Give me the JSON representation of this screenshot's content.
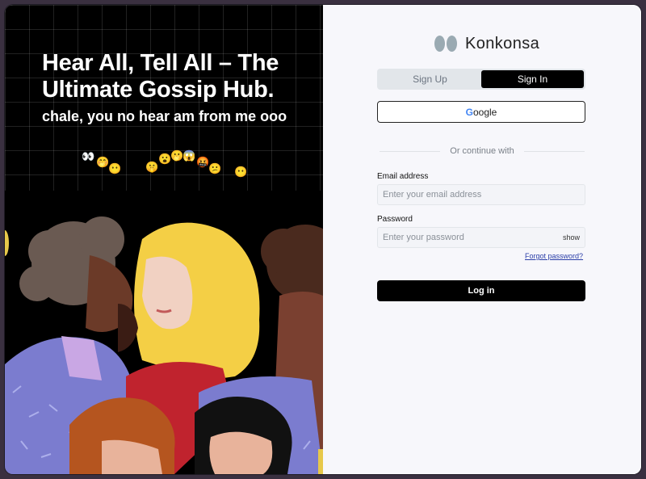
{
  "hero": {
    "title": "Hear All, Tell All – The Ultimate Gossip Hub.",
    "subtitle": "chale, you no hear am from me ooo",
    "emojis": [
      "👀",
      "🤭",
      "😶",
      "🤫",
      "😮",
      "🫢",
      "😱",
      "🤬",
      "😕",
      "😶"
    ]
  },
  "brand": {
    "name": "Konkonsa"
  },
  "tabs": {
    "sign_up": "Sign Up",
    "sign_in": "Sign In",
    "active": "Sign In"
  },
  "google_button": {
    "label": "oogle",
    "g": "G"
  },
  "divider_text": "Or continue with",
  "form": {
    "email_label": "Email address",
    "email_placeholder": "Enter your email address",
    "email_value": "",
    "password_label": "Password",
    "password_placeholder": "Enter your password",
    "password_value": "",
    "show_label": "show",
    "forgot_label": "Forgot password?",
    "login_label": "Log in"
  },
  "colors": {
    "hero_bg": "#000000",
    "accent": "#000000",
    "link": "#2b3ea8",
    "logo_mark": "#9aaab2"
  }
}
